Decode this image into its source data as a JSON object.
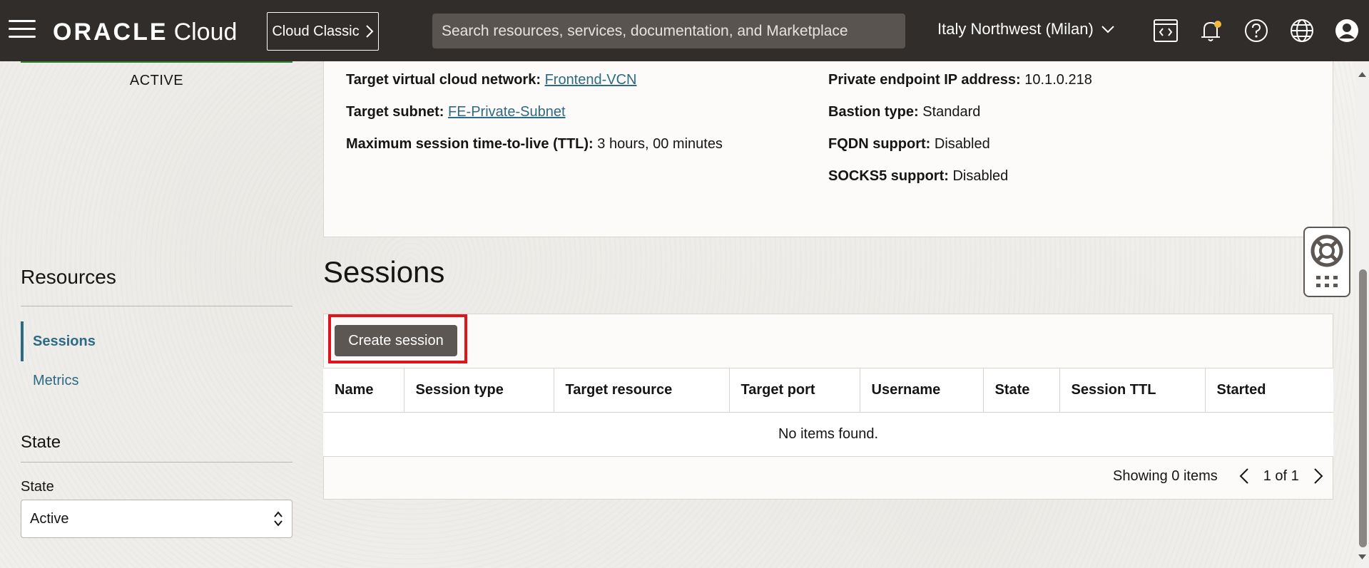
{
  "header": {
    "brand_main": "ORACLE",
    "brand_sub": "Cloud",
    "classic_label": "Cloud Classic",
    "search_placeholder": "Search resources, services, documentation, and Marketplace",
    "region": "Italy Northwest (Milan)"
  },
  "sidebar": {
    "status": "ACTIVE",
    "resources_title": "Resources",
    "items": [
      {
        "label": "Sessions",
        "selected": true
      },
      {
        "label": "Metrics",
        "selected": false
      }
    ],
    "state_title": "State",
    "state_label": "State",
    "state_value": "Active"
  },
  "details": {
    "target_vcn_label": "Target virtual cloud network:",
    "target_vcn_value": "Frontend-VCN",
    "target_subnet_label": "Target subnet:",
    "target_subnet_value": "FE-Private-Subnet",
    "ttl_label": "Maximum session time-to-live (TTL):",
    "ttl_value": "3 hours, 00 minutes",
    "private_ip_label": "Private endpoint IP address:",
    "private_ip_value": "10.1.0.218",
    "bastion_type_label": "Bastion type:",
    "bastion_type_value": "Standard",
    "fqdn_label": "FQDN support:",
    "fqdn_value": "Disabled",
    "socks5_label": "SOCKS5 support:",
    "socks5_value": "Disabled"
  },
  "sessions": {
    "title": "Sessions",
    "create_button": "Create session",
    "columns": [
      "Name",
      "Session type",
      "Target resource",
      "Target port",
      "Username",
      "State",
      "Session TTL",
      "Started"
    ],
    "empty_message": "No items found.",
    "showing": "Showing 0 items",
    "page": "1 of 1"
  },
  "colors": {
    "header_bg": "#312d2a",
    "link": "#2c6a85",
    "highlight": "#e0141b",
    "active_status": "#2f7d2f"
  }
}
